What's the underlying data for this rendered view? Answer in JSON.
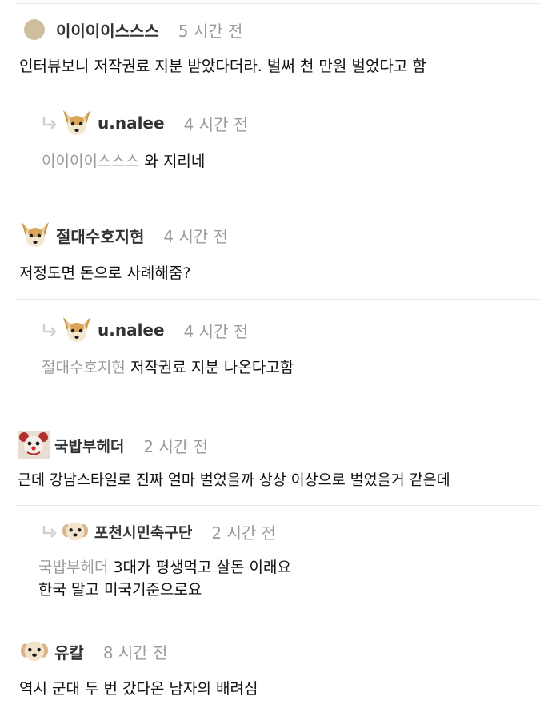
{
  "colors": {
    "text": "#111111",
    "muted": "#9a9a9a",
    "author": "#333333",
    "separator": "#e4e4e4"
  },
  "comments": [
    {
      "author": "이이이이스스스",
      "time": "5 시간 전",
      "avatar_icon": "beige-circle-avatar",
      "text": "인터뷰보니 저작권료 지분 받았다더라. 벌써 천 만원 벌었다고 함"
    },
    {
      "author": "u.nalee",
      "time": "4 시간 전",
      "avatar_icon": "chihuahua-avatar",
      "is_reply": true,
      "mention": "이이이이스스스",
      "text": "와 지리네"
    },
    {
      "author": "절대수호지현",
      "time": "4 시간 전",
      "avatar_icon": "chihuahua-avatar",
      "text": "저정도면 돈으로 사례해줌?"
    },
    {
      "author": "u.nalee",
      "time": "4 시간 전",
      "avatar_icon": "chihuahua-avatar",
      "is_reply": true,
      "mention": "절대수호지현",
      "text": "저작권료 지분 나온다고함"
    },
    {
      "author": "국밥부헤더",
      "time": "2 시간 전",
      "avatar_icon": "clown-avatar",
      "text": "근데 강남스타일로 진짜 얼마 벌었을까 상상 이상으로 벌었을거 같은데"
    },
    {
      "author": "포천시민축구단",
      "time": "2 시간 전",
      "avatar_icon": "puppy-avatar",
      "is_reply": true,
      "mention": "국밥부헤더",
      "text": "3대가 평생먹고 살돈 이래요",
      "text2": "한국 말고 미국기준으로요"
    },
    {
      "author": "유칼",
      "time": "8 시간 전",
      "avatar_icon": "puppy-avatar",
      "text": "역시 군대 두 번 갔다온 남자의 배려심"
    }
  ]
}
